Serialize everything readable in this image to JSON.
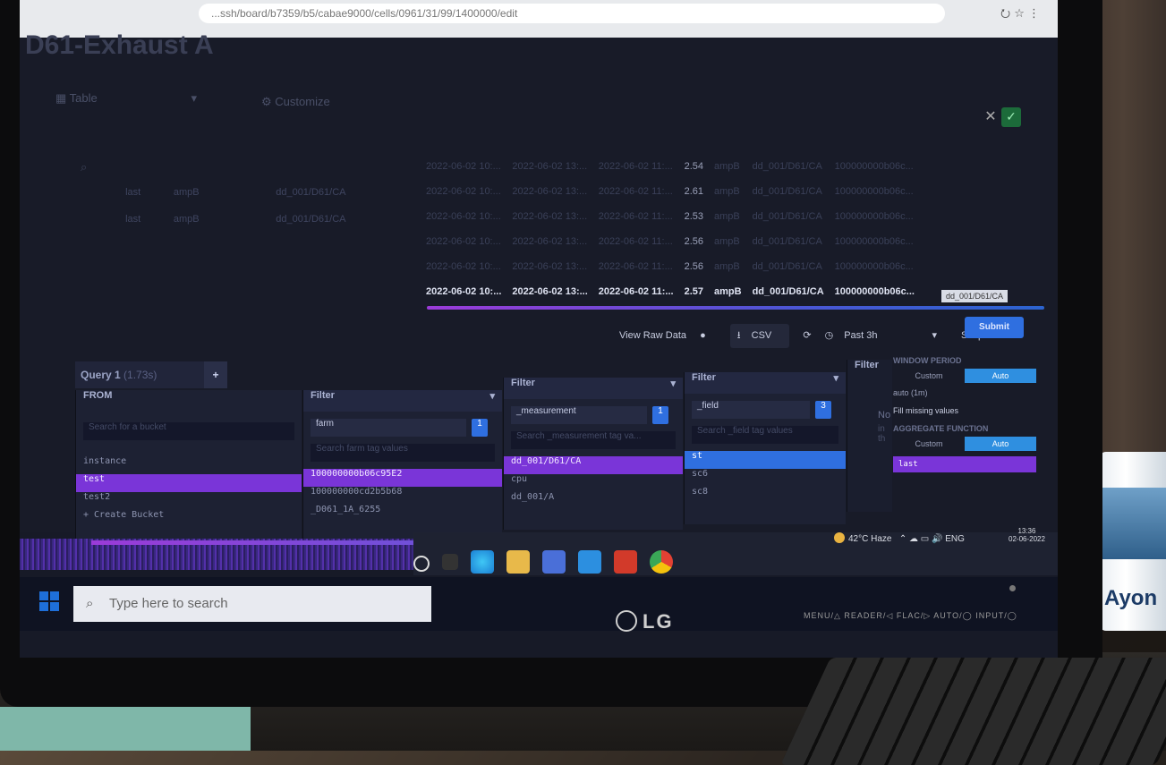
{
  "browser": {
    "url": "...ssh/board/b7359/b5/cabae9000/cells/0961/31/99/1400000/edit",
    "toolbar_icons": "⭮ ☆ ⋮"
  },
  "cell": {
    "title": "D61-Exhaust A",
    "visualization": "Table",
    "customize": "Customize"
  },
  "left_group": {
    "rows": [
      {
        "a": "last",
        "b": "ampB",
        "c": "dd_001/D61/CA"
      },
      {
        "a": "last",
        "b": "ampB",
        "c": "dd_001/D61/CA"
      }
    ]
  },
  "raw_table": {
    "rows": [
      {
        "t1": "2022-06-02 10:...",
        "t2": "2022-06-02 13:...",
        "t3": "2022-06-02 11:...",
        "v": "2.54",
        "f": "ampB",
        "m": "dd_001/D61/CA",
        "id": "100000000b06c..."
      },
      {
        "t1": "2022-06-02 10:...",
        "t2": "2022-06-02 13:...",
        "t3": "2022-06-02 11:...",
        "v": "2.61",
        "f": "ampB",
        "m": "dd_001/D61/CA",
        "id": "100000000b06c..."
      },
      {
        "t1": "2022-06-02 10:...",
        "t2": "2022-06-02 13:...",
        "t3": "2022-06-02 11:...",
        "v": "2.53",
        "f": "ampB",
        "m": "dd_001/D61/CA",
        "id": "100000000b06c..."
      },
      {
        "t1": "2022-06-02 10:...",
        "t2": "2022-06-02 13:...",
        "t3": "2022-06-02 11:...",
        "v": "2.56",
        "f": "ampB",
        "m": "dd_001/D61/CA",
        "id": "100000000b06c..."
      },
      {
        "t1": "2022-06-02 10:...",
        "t2": "2022-06-02 13:...",
        "t3": "2022-06-02 11:...",
        "v": "2.56",
        "f": "ampB",
        "m": "dd_001/D61/CA",
        "id": "100000000b06c..."
      },
      {
        "t1": "2022-06-02 10:...",
        "t2": "2022-06-02 13:...",
        "t3": "2022-06-02 11:...",
        "v": "2.57",
        "f": "ampB",
        "m": "dd_001/D61/CA",
        "id": "100000000b06c..."
      }
    ],
    "tooltip": "dd_001/D61/CA"
  },
  "toolbar": {
    "view_raw": "View Raw Data",
    "csv": "CSV",
    "range": "Past 3h",
    "script_editor": "Script Editor",
    "submit": "Submit"
  },
  "query": {
    "tab": "Query 1",
    "tab_time": "(1.73s)",
    "add": "+"
  },
  "from_panel": {
    "header": "FROM",
    "search": "Search for a bucket",
    "items": [
      "instance",
      "test",
      "test2",
      "+ Create Bucket"
    ]
  },
  "filter1": {
    "header": "Filter",
    "key": "farm",
    "count": "1",
    "search": "Search farm tag values",
    "items": [
      "100000000b06c95E2",
      "100000000cd2b5b68",
      "_D061_1A_6255"
    ]
  },
  "filter2": {
    "header": "Filter",
    "key": "_measurement",
    "count": "1",
    "search": "Search _measurement tag va...",
    "items": [
      "dd_001/D61/CA",
      "cpu",
      "dd_001/A"
    ]
  },
  "filter3": {
    "header": "Filter",
    "key": "_field",
    "count": "3",
    "search": "Search _field tag values",
    "items": [
      "st",
      "sc6",
      "sc8"
    ]
  },
  "filter4": {
    "header": "Filter",
    "no": "No",
    "in": "in th"
  },
  "window": {
    "window_period": "WINDOW PERIOD",
    "custom": "Custom",
    "auto": "Auto",
    "auto_value": "auto (1m)",
    "fill_missing": "Fill missing values",
    "aggregate": "AGGREGATE FUNCTION",
    "custom2": "Custom",
    "auto2": "Auto",
    "fn": "last"
  },
  "taskbar": {
    "search": "Type here to search",
    "weather": "42°C  Haze",
    "lang": "ENG",
    "time": "13:36",
    "date": "02-06-2022"
  },
  "monitor": {
    "brand": "LG",
    "osd": "MENU/△   READER/◁   FLAC/▷   AUTO/◯   INPUT/◯"
  },
  "mug": {
    "label": "Ayon"
  },
  "colors": {
    "accent_purple": "#7a35d8",
    "accent_blue": "#2f6fe0",
    "background": "#181b28"
  }
}
